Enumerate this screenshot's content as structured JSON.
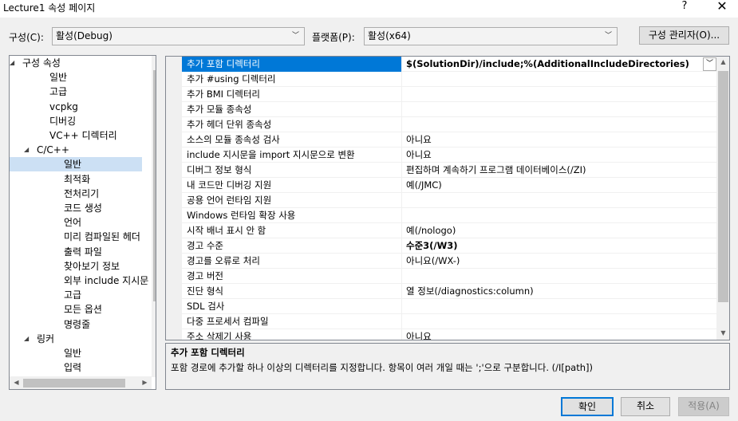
{
  "window": {
    "title": "Lecture1 속성 페이지",
    "help": "?",
    "close": "✕"
  },
  "config": {
    "config_label": "구성(C):",
    "config_value": "활성(Debug)",
    "platform_label": "플랫폼(P):",
    "platform_value": "활성(x64)",
    "manager_button": "구성 관리자(O)..."
  },
  "tree": {
    "items": [
      {
        "label": "구성 속성",
        "arrow": "◢"
      },
      {
        "label": "일반"
      },
      {
        "label": "고급"
      },
      {
        "label": "vcpkg"
      },
      {
        "label": "디버깅"
      },
      {
        "label": "VC++ 디렉터리"
      },
      {
        "label": "C/C++",
        "arrow": "◢"
      },
      {
        "label": "일반",
        "selected": true
      },
      {
        "label": "최적화"
      },
      {
        "label": "전처리기"
      },
      {
        "label": "코드 생성"
      },
      {
        "label": "언어"
      },
      {
        "label": "미리 컴파일된 헤더"
      },
      {
        "label": "출력 파일"
      },
      {
        "label": "찾아보기 정보"
      },
      {
        "label": "외부 include 지시문"
      },
      {
        "label": "고급"
      },
      {
        "label": "모든 옵션"
      },
      {
        "label": "명령줄"
      },
      {
        "label": "링커",
        "arrow": "◢"
      },
      {
        "label": "일반"
      },
      {
        "label": "입력"
      }
    ]
  },
  "grid": {
    "rows": [
      {
        "name": "추가 포함 디렉터리",
        "value": "$(SolutionDir)/include;%(AdditionalIncludeDirectories)",
        "bold": true,
        "selected": true
      },
      {
        "name": "추가 #using 디렉터리",
        "value": ""
      },
      {
        "name": "추가 BMI 디렉터리",
        "value": ""
      },
      {
        "name": "추가 모듈 종속성",
        "value": ""
      },
      {
        "name": "추가 헤더 단위 종속성",
        "value": ""
      },
      {
        "name": "소스의 모듈 종속성 검사",
        "value": "아니요"
      },
      {
        "name": "include 지시문을 import 지시문으로 변환",
        "value": "아니요"
      },
      {
        "name": "디버그 정보 형식",
        "value": "편집하며 계속하기 프로그램 데이터베이스(/ZI)"
      },
      {
        "name": "내 코드만 디버깅 지원",
        "value": "예(/JMC)"
      },
      {
        "name": "공용 언어 런타임 지원",
        "value": ""
      },
      {
        "name": "Windows 런타임 확장 사용",
        "value": ""
      },
      {
        "name": "시작 배너 표시 안 함",
        "value": "예(/nologo)"
      },
      {
        "name": "경고 수준",
        "value": "수준3(/W3)",
        "bold": true
      },
      {
        "name": "경고를 오류로 처리",
        "value": "아니요(/WX-)"
      },
      {
        "name": "경고 버전",
        "value": ""
      },
      {
        "name": "진단 형식",
        "value": "열 정보(/diagnostics:column)"
      },
      {
        "name": "SDL 검사",
        "value": ""
      },
      {
        "name": "다중 프로세서 컴파일",
        "value": ""
      },
      {
        "name": "주소 삭제기 사용",
        "value": "아니요"
      }
    ]
  },
  "description": {
    "title": "추가 포함 디렉터리",
    "text": "포함 경로에 추가할 하나 이상의 디렉터리를 지정합니다. 항목이 여러 개일 때는 ';'으로 구분합니다. (/I[path])"
  },
  "buttons": {
    "ok": "확인",
    "cancel": "취소",
    "apply": "적용(A)"
  }
}
